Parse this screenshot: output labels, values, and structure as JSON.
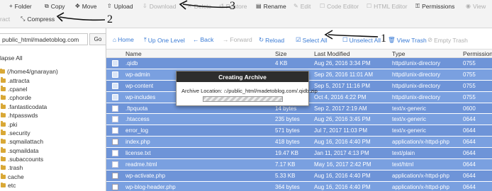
{
  "toolbar": {
    "row1": [
      {
        "label": "Folder",
        "icon": "plus-icon",
        "enabled": true
      },
      {
        "label": "Copy",
        "icon": "copy-icon",
        "enabled": true
      },
      {
        "label": "Move",
        "icon": "move-icon",
        "enabled": true
      },
      {
        "label": "Upload",
        "icon": "upload-icon",
        "enabled": true
      },
      {
        "label": "Download",
        "icon": "download-icon",
        "enabled": false
      },
      {
        "label": "Delete",
        "icon": "delete-icon",
        "enabled": false
      },
      {
        "label": "Restore",
        "icon": "restore-icon",
        "enabled": false
      },
      {
        "label": "Rename",
        "icon": "rename-icon",
        "enabled": true
      },
      {
        "label": "Edit",
        "icon": "pencil-icon",
        "enabled": false
      },
      {
        "label": "Code Editor",
        "icon": "code-editor-icon",
        "enabled": false
      },
      {
        "label": "HTML Editor",
        "icon": "html-editor-icon",
        "enabled": false
      },
      {
        "label": "Permissions",
        "icon": "key-icon",
        "enabled": true
      },
      {
        "label": "View",
        "icon": "eye-icon",
        "enabled": false
      }
    ],
    "row2": [
      {
        "label": "ract",
        "icon": "extract-icon",
        "enabled": false
      },
      {
        "label": "Compress",
        "icon": "compress-icon",
        "enabled": true
      }
    ]
  },
  "sidebar": {
    "path_value": "public_html/madetoblog.com",
    "go_label": "Go",
    "collapse_label": "lapse All",
    "tree": [
      "(/home4/gnarayan)",
      ".attracta",
      ".cpanel",
      ".cphorde",
      ".fantasticodata",
      ".htpasswds",
      ".pki",
      ".security",
      ".sqmailattach",
      ".sqmaildata",
      ".subaccounts",
      ".trash",
      "cache",
      "etc"
    ]
  },
  "actions": [
    {
      "label": "Home",
      "icon": "home-icon",
      "enabled": true
    },
    {
      "label": "Up One Level",
      "icon": "up-level-icon",
      "enabled": true
    },
    {
      "label": "Back",
      "icon": "back-arrow-icon",
      "enabled": true
    },
    {
      "label": "Forward",
      "icon": "forward-arrow-icon",
      "enabled": false
    },
    {
      "label": "Reload",
      "icon": "reload-icon",
      "enabled": true
    },
    {
      "label": "Select All",
      "icon": "checkbox-icon",
      "enabled": true
    },
    {
      "label": "Unselect All",
      "icon": "unselect-icon",
      "enabled": true
    },
    {
      "label": "View Trash",
      "icon": "trash-icon",
      "enabled": true
    },
    {
      "label": "Empty Trash",
      "icon": "empty-trash-icon",
      "enabled": false
    }
  ],
  "table": {
    "columns": [
      "Name",
      "Size",
      "Last Modified",
      "Type",
      "Permissions"
    ],
    "rows": [
      {
        "name": ".qidb",
        "size": "4 KB",
        "modified": "Aug 26, 2016 3:34 PM",
        "type": "httpd/unix-directory",
        "perms": "0755",
        "icon": "folder-icon"
      },
      {
        "name": "wp-admin",
        "size": "",
        "modified": "Sep 26, 2016 11:01 AM",
        "type": "httpd/unix-directory",
        "perms": "0755",
        "icon": "folder-icon"
      },
      {
        "name": "wp-content",
        "size": "",
        "modified": "Sep 5, 2017 11:16 PM",
        "type": "httpd/unix-directory",
        "perms": "0755",
        "icon": "folder-icon"
      },
      {
        "name": "wp-includes",
        "size": "",
        "modified": "Oct 4, 2016 4:22 PM",
        "type": "httpd/unix-directory",
        "perms": "0755",
        "icon": "folder-icon"
      },
      {
        "name": ".ftpquota",
        "size": "14 bytes",
        "modified": "Sep 2, 2017 2:19 AM",
        "type": "text/x-generic",
        "perms": "0600",
        "icon": "text-file-icon"
      },
      {
        "name": ".htaccess",
        "size": "235 bytes",
        "modified": "Aug 26, 2016 3:45 PM",
        "type": "text/x-generic",
        "perms": "0644",
        "icon": "text-file-icon"
      },
      {
        "name": "error_log",
        "size": "571 bytes",
        "modified": "Jul 7, 2017 11:03 PM",
        "type": "text/x-generic",
        "perms": "0644",
        "icon": "text-file-icon"
      },
      {
        "name": "index.php",
        "size": "418 bytes",
        "modified": "Aug 16, 2016 4:40 PM",
        "type": "application/x-httpd-php",
        "perms": "0644",
        "icon": "php-file-icon"
      },
      {
        "name": "license.txt",
        "size": "19.47 KB",
        "modified": "Jan 11, 2017 4:13 PM",
        "type": "text/plain",
        "perms": "0644",
        "icon": "text-file-icon"
      },
      {
        "name": "readme.html",
        "size": "7.17 KB",
        "modified": "May 16, 2017 2:42 PM",
        "type": "text/html",
        "perms": "0644",
        "icon": "html-file-icon"
      },
      {
        "name": "wp-activate.php",
        "size": "5.33 KB",
        "modified": "Aug 16, 2016 4:40 PM",
        "type": "application/x-httpd-php",
        "perms": "0644",
        "icon": "php-file-icon"
      },
      {
        "name": "wp-blog-header.php",
        "size": "364 bytes",
        "modified": "Aug 16, 2016 4:40 PM",
        "type": "application/x-httpd-php",
        "perms": "0644",
        "icon": "php-file-icon"
      }
    ]
  },
  "modal": {
    "title": "Creating Archive",
    "location_label": "Archive Location:",
    "location_path": "/public_html/madetoblog.com/.qidb.zip"
  },
  "annotations": [
    {
      "number": "1"
    },
    {
      "number": "2"
    },
    {
      "number": "3"
    }
  ],
  "colors": {
    "selected_row": "#7aa0e0",
    "link": "#3a7bd5",
    "folder": "#d9a836",
    "modal_header": "#2d2d2d"
  }
}
